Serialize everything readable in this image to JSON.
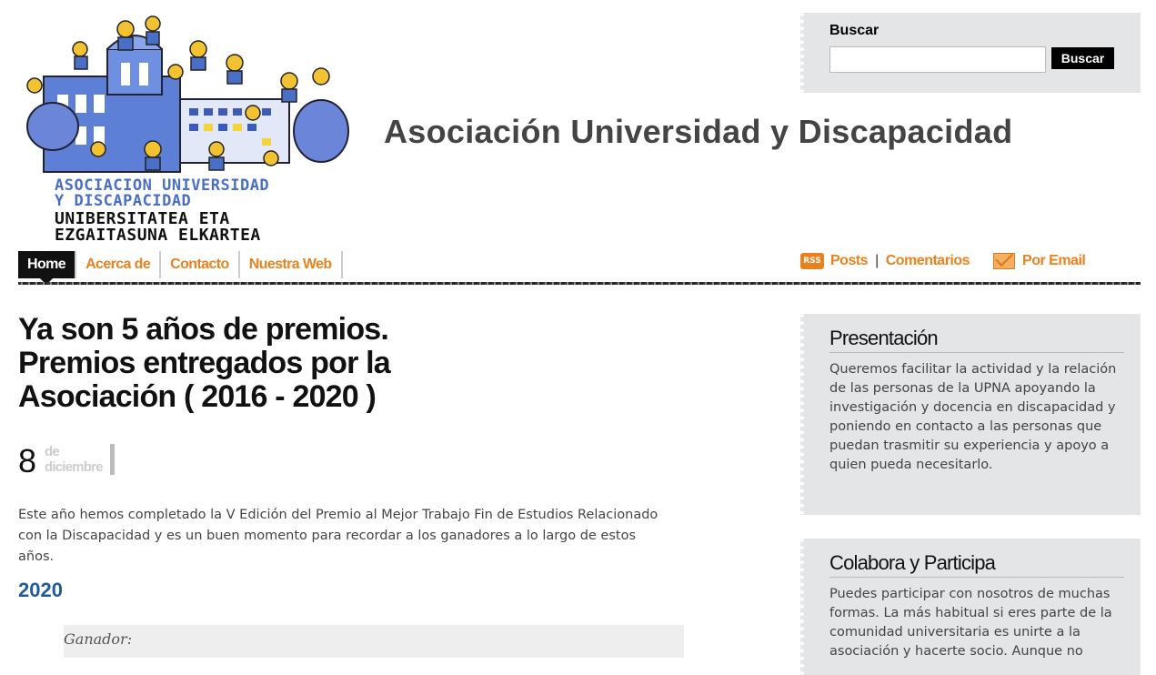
{
  "header": {
    "logo_lines": [
      "ASOCIACION UNIVERSIDAD",
      "Y DISCAPACIDAD",
      "UNIBERSITATEA ETA",
      "EZGAITASUNA ELKARTEA"
    ],
    "site_title": "Asociación Universidad y Discapacidad"
  },
  "search": {
    "label": "Buscar",
    "input_value": "",
    "button_label": "Buscar"
  },
  "nav": {
    "items": [
      {
        "label": "Home",
        "active": true
      },
      {
        "label": "Acerca de"
      },
      {
        "label": "Contacto"
      },
      {
        "label": "Nuestra Web"
      }
    ]
  },
  "feeds": {
    "rss_icon_text": "RSS",
    "posts": "Posts",
    "separator": "|",
    "comments": "Comentarios",
    "email": "Por Email",
    "accent_color": "#e8821e"
  },
  "post": {
    "title": "Ya son 5 años de premios. Premios entregados por la Asociación ( 2016 - 2020 )",
    "date_day": "8",
    "date_month_line1": "de",
    "date_month_line2": "diciembre",
    "body": " Este año hemos completado la V Edición del Premio al Mejor Trabajo Fin de Estudios Relacionado con la Discapacidad y es un buen momento para recordar a los ganadores a lo largo de estos años.",
    "year_heading": "2020",
    "winner_label": "Ganador:"
  },
  "sidebar": {
    "widgets": [
      {
        "title": "Presentación",
        "text": "Queremos facilitar la actividad y la relación de las personas de la UPNA apoyando la investigación y docencia en discapacidad y poniendo en contacto a las personas que puedan trasmitir su experiencia y apoyo a quien pueda necesitarlo."
      },
      {
        "title": "Colabora y Participa",
        "text": "Puedes participar con nosotros de muchas formas. La más habitual si eres parte de la comunidad universitaria es unirte a la asociación y hacerte socio. Aunque no"
      }
    ]
  }
}
